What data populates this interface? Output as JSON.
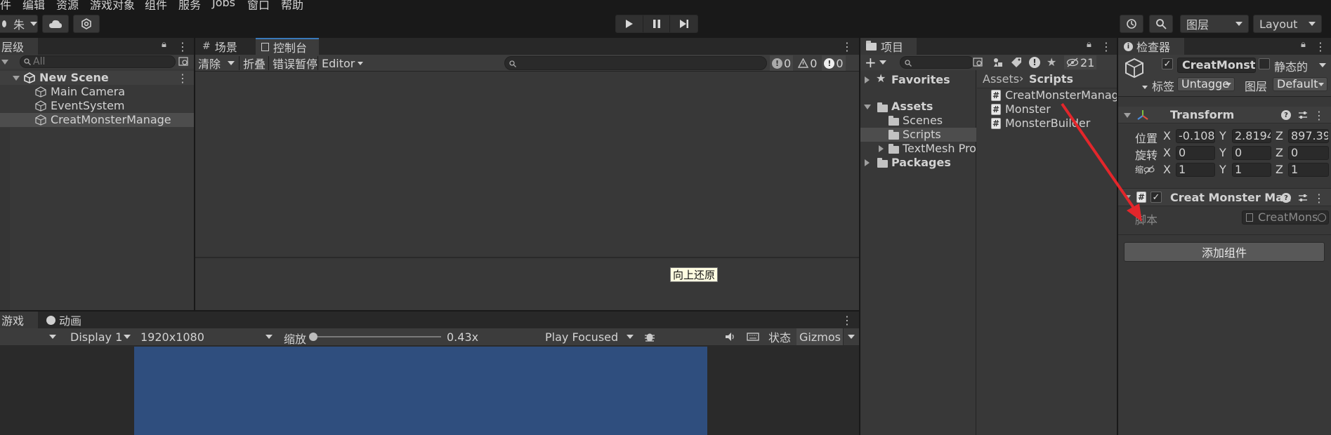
{
  "menubar": {
    "items": [
      "件",
      "编辑",
      "资源",
      "游戏对象",
      "组件",
      "服务",
      "Jobs",
      "窗口",
      "帮助"
    ]
  },
  "toolbar": {
    "account_label": "朱",
    "layers_label": "图层",
    "layout_label": "Layout",
    "icons": [
      "cloud-icon",
      "collab-icon",
      "play-icon",
      "pause-icon",
      "step-icon",
      "history-icon",
      "search-icon"
    ]
  },
  "hierarchy": {
    "tab_label": "层级",
    "search_placeholder": "All",
    "scene_name": "New Scene",
    "items": [
      "Main Camera",
      "EventSystem",
      "CreatMonsterManage"
    ]
  },
  "center_tabs": {
    "scene": "场景",
    "console": "控制台"
  },
  "console": {
    "clear_label": "清除",
    "collapse_label": "折叠",
    "error_pause_label": "错误暂停",
    "editor_label": "Editor",
    "info_count": "0",
    "warning_count": "0",
    "error_count": "0",
    "tooltip": "向上还原"
  },
  "game": {
    "tab_label": "游戏",
    "animation_tab_label": "动画",
    "display_label": "Display 1",
    "resolution_label": "1920x1080",
    "scale_label": "缩放",
    "scale_value": "0.43x",
    "scale_slider_fraction": 0.0,
    "play_mode_label": "Play Focused",
    "stats_label": "状态",
    "gizmos_label": "Gizmos",
    "viewport_color": "#2f4e7e"
  },
  "project": {
    "tab_label": "项目",
    "hidden_count": "21",
    "favorites_label": "Favorites",
    "assets_label": "Assets",
    "folders": [
      "Scenes",
      "Scripts",
      "TextMesh Pro"
    ],
    "packages_label": "Packages",
    "breadcrumb": [
      "Assets",
      "Scripts"
    ],
    "files": [
      "CreatMonsterManage",
      "Monster",
      "MonsterBuilder"
    ]
  },
  "inspector": {
    "tab_label": "检查器",
    "object_name": "CreatMonster",
    "static_label": "静态的",
    "tag_label": "标签",
    "tag_value": "Untagge",
    "layer_label": "图层",
    "layer_value": "Default",
    "transform_title": "Transform",
    "position_label": "位置",
    "rotation_label": "旋转",
    "scale_label": "缩",
    "axis_x": "X",
    "axis_y": "Y",
    "axis_z": "Z",
    "position": {
      "x": "-0.108",
      "y": "2.8194",
      "z": "897.39"
    },
    "rotation": {
      "x": "0",
      "y": "0",
      "z": "0"
    },
    "scale": {
      "x": "1",
      "y": "1",
      "z": "1"
    },
    "component_title": "Creat Monster Man",
    "script_label": "脚本",
    "script_value": "CreatMons",
    "add_component_label": "添加组件"
  },
  "colors": {
    "accent": "#3a79bb",
    "annotation_arrow": "#e3262b"
  }
}
